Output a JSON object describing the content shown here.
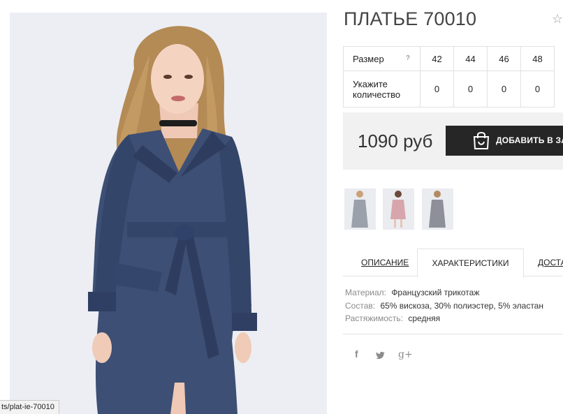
{
  "product": {
    "title": "ПЛАТЬЕ 70010",
    "favorite_icon": "star-outline-icon",
    "price": "1090 руб",
    "add_to_cart": "ДОБАВИТЬ В ЗАК"
  },
  "size_table": {
    "size_label": "Размер",
    "help_mark": "?",
    "qty_label": "Укажите количество",
    "sizes": [
      "42",
      "44",
      "46",
      "48"
    ],
    "quantities": [
      "0",
      "0",
      "0",
      "0"
    ]
  },
  "thumbnails": [
    {
      "name": "thumb-grey-dress",
      "dress_color": "#9aa1ab"
    },
    {
      "name": "thumb-pink-dress",
      "dress_color": "#d7a6ac"
    },
    {
      "name": "thumb-grey-dress-2",
      "dress_color": "#8d9098"
    }
  ],
  "tabs": [
    {
      "label": "ОПИСАНИЕ",
      "active": false
    },
    {
      "label": "ХАРАКТЕРИСТИКИ",
      "active": true
    },
    {
      "label": "ДОСТА",
      "active": false
    }
  ],
  "specs": [
    {
      "key": "Материал:",
      "value": "Французский трикотаж"
    },
    {
      "key": "Состав:",
      "value": "65% вискоза, 30% полиэстер, 5% эластан"
    },
    {
      "key": "Растяжимость:",
      "value": "средняя"
    }
  ],
  "social": {
    "facebook": "f",
    "twitter_icon": "twitter-icon",
    "googleplus": "g+"
  },
  "status_url": "ts/plat-ie-70010",
  "colors": {
    "dress": "#3d4f74",
    "photo_bg": "#eceef3",
    "button_bg": "#262626",
    "price_bg": "#f1f1f1"
  }
}
